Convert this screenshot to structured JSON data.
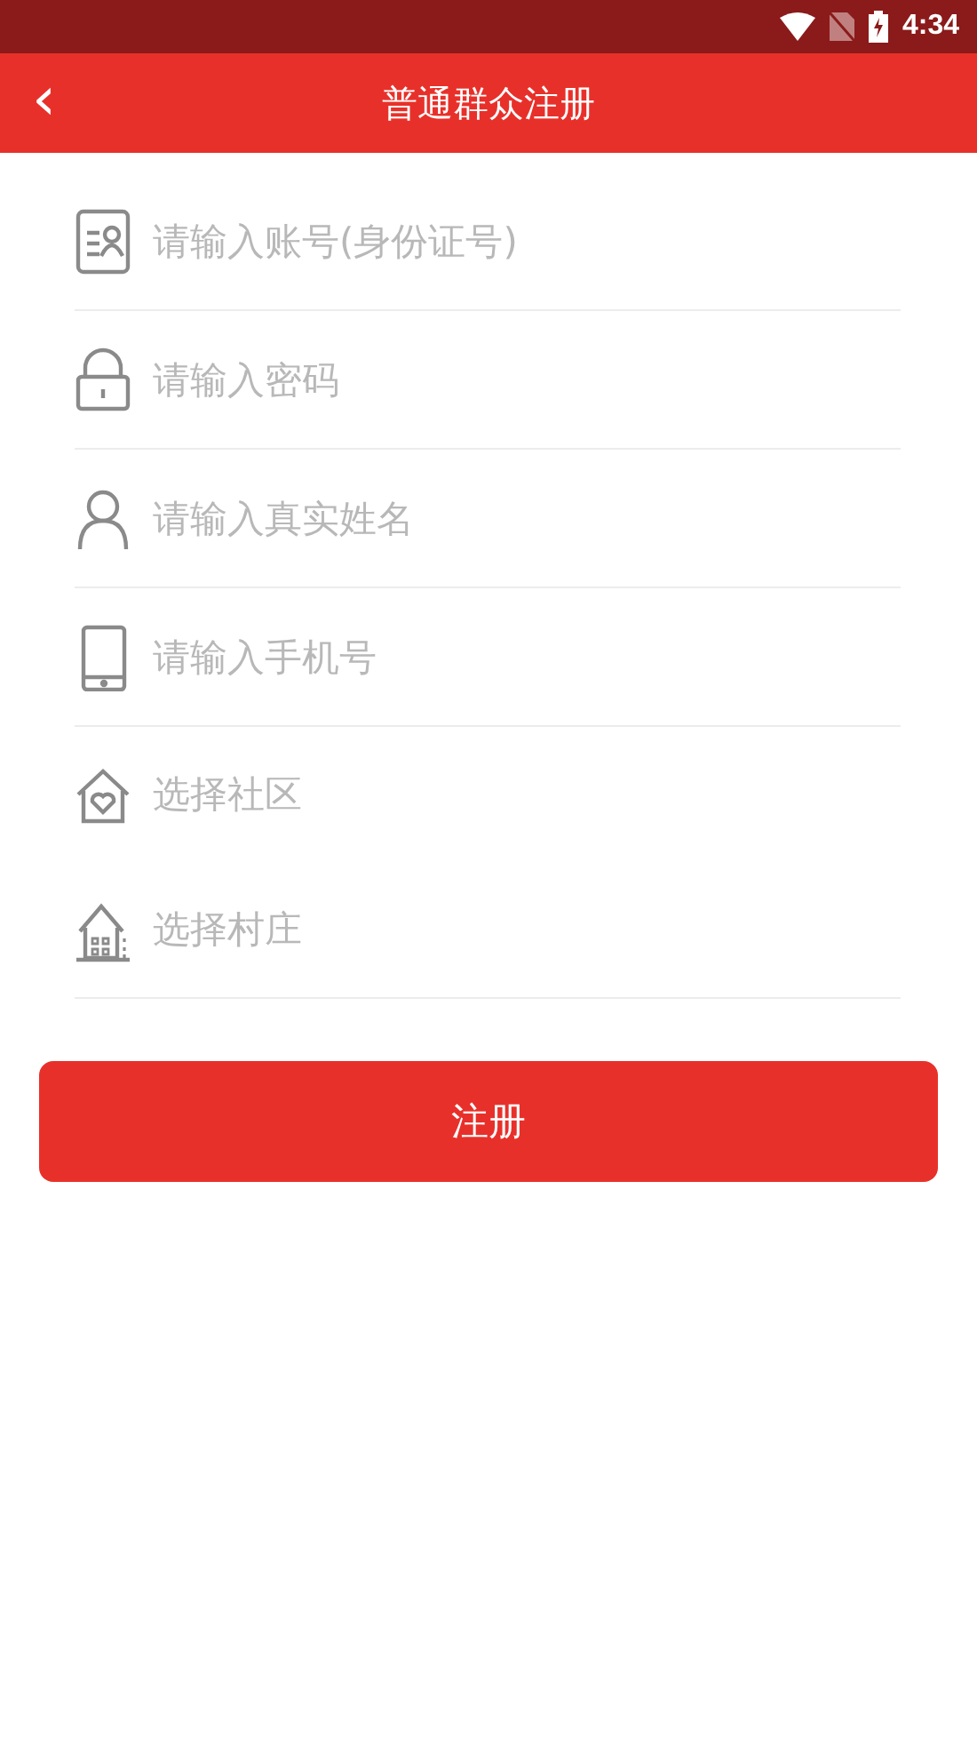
{
  "status_bar": {
    "time": "4:34"
  },
  "toolbar": {
    "back": "‹",
    "title": "普通群众注册"
  },
  "inputs": [
    {
      "kind": "id",
      "placeholder": "请输入账号(身份证号)"
    },
    {
      "kind": "lock",
      "placeholder": "请输入密码"
    },
    {
      "kind": "person",
      "placeholder": "请输入真实姓名"
    },
    {
      "kind": "phone",
      "placeholder": "请输入手机号"
    }
  ],
  "selects": [
    {
      "kind": "community",
      "label": "选择社区"
    },
    {
      "kind": "village",
      "label": "选择村庄"
    }
  ],
  "submit": "注册"
}
